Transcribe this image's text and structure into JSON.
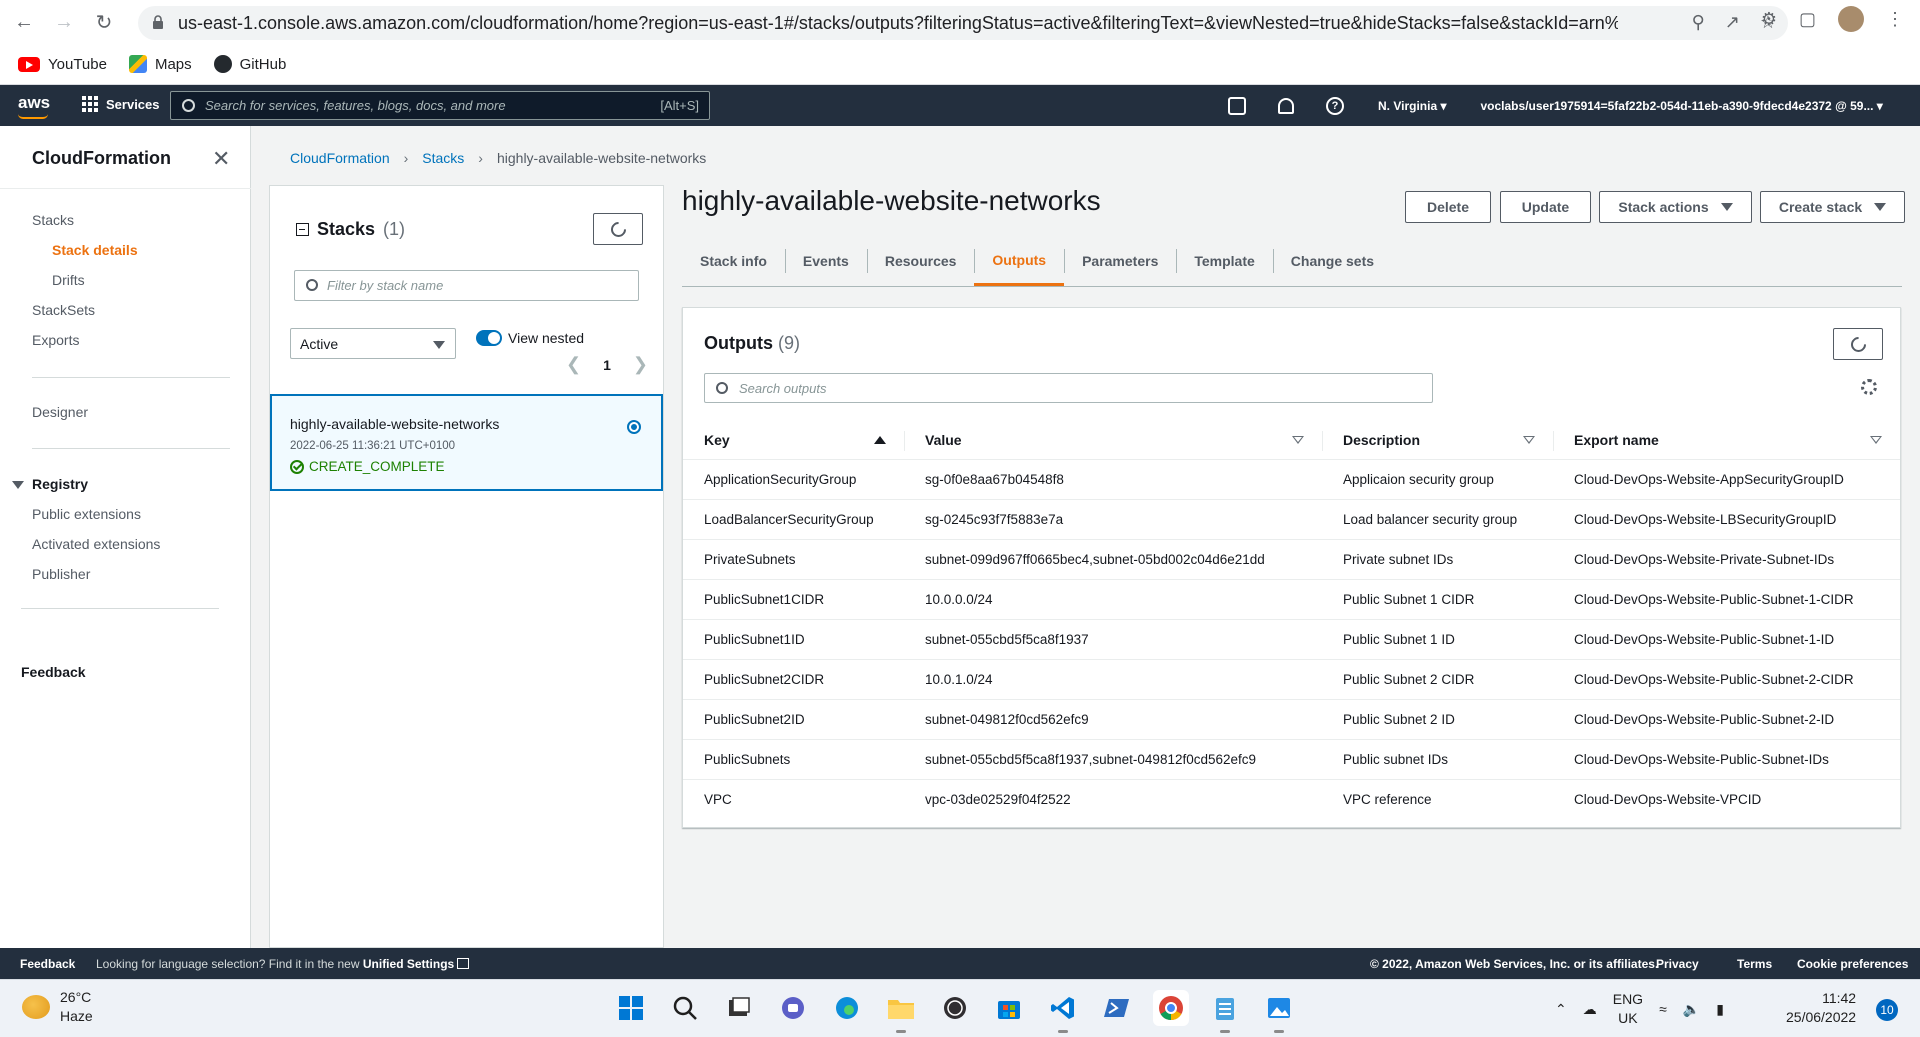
{
  "browser": {
    "url": "us-east-1.console.aws.amazon.com/cloudformation/home?region=us-east-1#/stacks/outputs?filteringStatus=active&filteringText=&viewNested=true&hideStacks=false&stackId=arn%3...",
    "bookmarks": [
      {
        "label": "YouTube",
        "icon": "youtube-icon"
      },
      {
        "label": "Maps",
        "icon": "maps-icon"
      },
      {
        "label": "GitHub",
        "icon": "github-icon"
      }
    ]
  },
  "aws_nav": {
    "logo": "aws",
    "services_label": "Services",
    "search_placeholder": "Search for services, features, blogs, docs, and more",
    "search_shortcut": "[Alt+S]",
    "region": "N. Virginia",
    "account": "voclabs/user1975914=5faf22b2-054d-11eb-a390-9fdecd4e2372 @ 59..."
  },
  "sidebar": {
    "title": "CloudFormation",
    "items": [
      {
        "label": "Stacks"
      },
      {
        "label": "Stack details"
      },
      {
        "label": "Drifts"
      },
      {
        "label": "StackSets"
      },
      {
        "label": "Exports"
      },
      {
        "label": "Designer"
      },
      {
        "label": "Registry"
      },
      {
        "label": "Public extensions"
      },
      {
        "label": "Activated extensions"
      },
      {
        "label": "Publisher"
      },
      {
        "label": "Feedback"
      }
    ]
  },
  "breadcrumb": [
    "CloudFormation",
    "Stacks",
    "highly-available-website-networks"
  ],
  "stacks_panel": {
    "title": "Stacks",
    "count": "(1)",
    "filter_placeholder": "Filter by stack name",
    "status_filter": "Active",
    "view_nested_label": "View nested",
    "view_nested": true,
    "page": "1",
    "stack": {
      "name": "highly-available-website-networks",
      "date": "2022-06-25 11:36:21 UTC+0100",
      "status": "CREATE_COMPLETE"
    }
  },
  "detail": {
    "title": "highly-available-website-networks",
    "buttons": {
      "delete": "Delete",
      "update": "Update",
      "stack_actions": "Stack actions",
      "create_stack": "Create stack"
    },
    "tabs": [
      "Stack info",
      "Events",
      "Resources",
      "Outputs",
      "Parameters",
      "Template",
      "Change sets"
    ],
    "active_tab": "Outputs"
  },
  "outputs": {
    "title": "Outputs",
    "count": "(9)",
    "search_placeholder": "Search outputs",
    "columns": [
      "Key",
      "Value",
      "Description",
      "Export name"
    ],
    "rows": [
      [
        "ApplicationSecurityGroup",
        "sg-0f0e8aa67b04548f8",
        "Applicaion security group",
        "Cloud-DevOps-Website-AppSecurityGroupID"
      ],
      [
        "LoadBalancerSecurityGroup",
        "sg-0245c93f7f5883e7a",
        "Load balancer security group",
        "Cloud-DevOps-Website-LBSecurityGroupID"
      ],
      [
        "PrivateSubnets",
        "subnet-099d967ff0665bec4,subnet-05bd002c04d6e21dd",
        "Private subnet IDs",
        "Cloud-DevOps-Website-Private-Subnet-IDs"
      ],
      [
        "PublicSubnet1CIDR",
        "10.0.0.0/24",
        "Public Subnet 1 CIDR",
        "Cloud-DevOps-Website-Public-Subnet-1-CIDR"
      ],
      [
        "PublicSubnet1ID",
        "subnet-055cbd5f5ca8f1937",
        "Public Subnet 1 ID",
        "Cloud-DevOps-Website-Public-Subnet-1-ID"
      ],
      [
        "PublicSubnet2CIDR",
        "10.0.1.0/24",
        "Public Subnet 2 CIDR",
        "Cloud-DevOps-Website-Public-Subnet-2-CIDR"
      ],
      [
        "PublicSubnet2ID",
        "subnet-049812f0cd562efc9",
        "Public Subnet 2 ID",
        "Cloud-DevOps-Website-Public-Subnet-2-ID"
      ],
      [
        "PublicSubnets",
        "subnet-055cbd5f5ca8f1937,subnet-049812f0cd562efc9",
        "Public subnet IDs",
        "Cloud-DevOps-Website-Public-Subnet-IDs"
      ],
      [
        "VPC",
        "vpc-03de02529f04f2522",
        "VPC reference",
        "Cloud-DevOps-Website-VPCID"
      ]
    ]
  },
  "footer": {
    "feedback": "Feedback",
    "lang_text": "Looking for language selection? Find it in the new",
    "lang_link": "Unified Settings",
    "copyright": "© 2022, Amazon Web Services, Inc. or its affiliates.",
    "privacy": "Privacy",
    "terms": "Terms",
    "cookies": "Cookie preferences"
  },
  "taskbar": {
    "temperature": "26°C",
    "weather": "Haze",
    "lang_top": "ENG",
    "lang_bottom": "UK",
    "time": "11:42",
    "date": "25/06/2022",
    "notifications": "10"
  },
  "colors": {
    "accent": "#ec7211",
    "link": "#0073bb",
    "success": "#1d8102",
    "nav_bg": "#232f3e"
  }
}
